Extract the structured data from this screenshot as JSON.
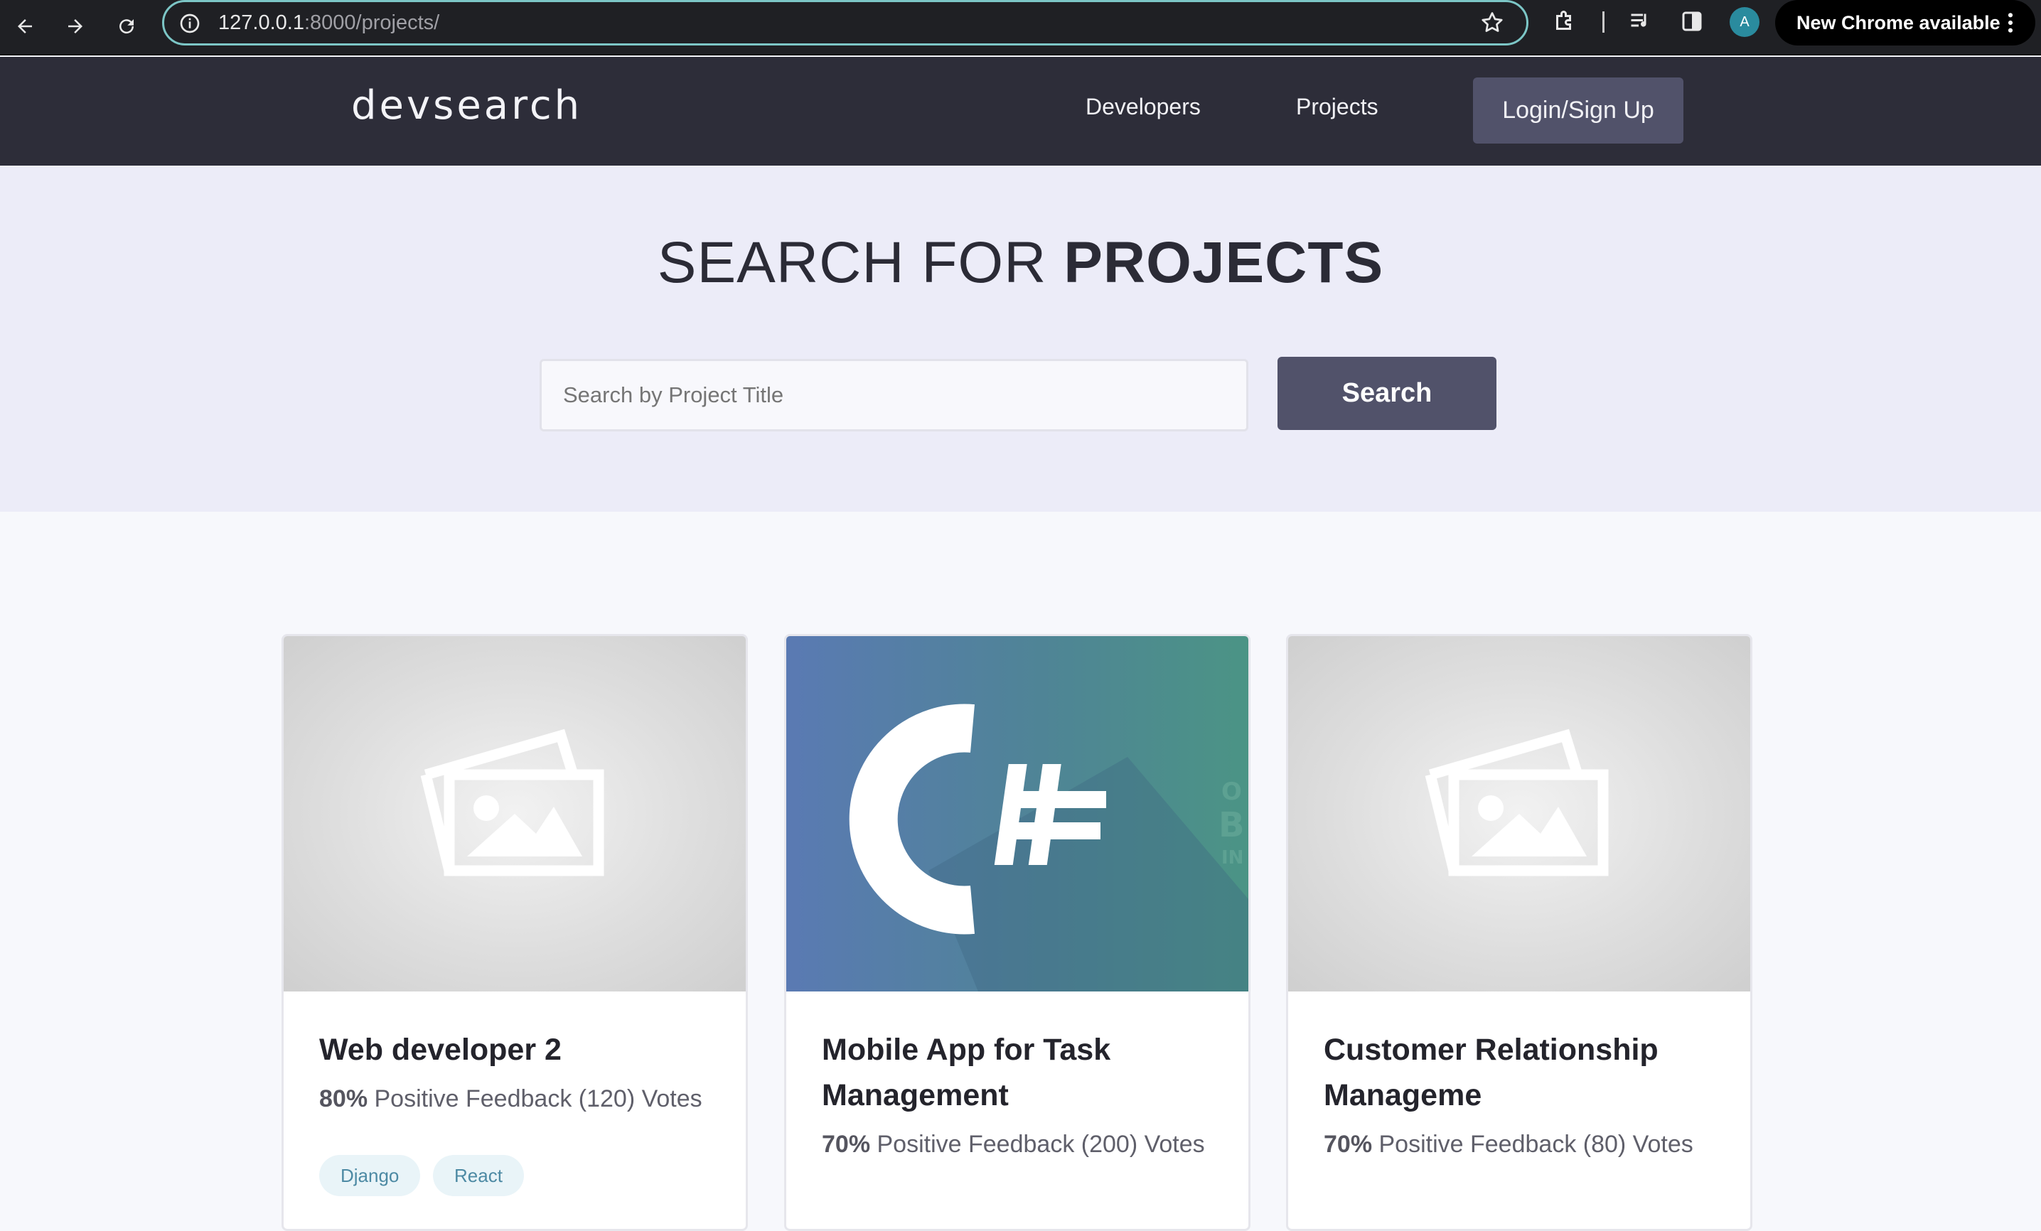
{
  "browser": {
    "url_host": "127.0.0.1",
    "url_path": ":8000/projects/",
    "profile_initial": "A",
    "update_label": "New Chrome available"
  },
  "header": {
    "logo": "devsearch",
    "nav": [
      {
        "label": "Developers"
      },
      {
        "label": "Projects"
      }
    ],
    "login_label": "Login/Sign Up"
  },
  "hero": {
    "title_light": "SEARCH FOR ",
    "title_bold": "PROJECTS",
    "search_placeholder": "Search by Project Title",
    "search_button": "Search"
  },
  "projects": [
    {
      "title": "Web developer 2",
      "feedback_pct": "80%",
      "feedback_text": " Positive Feedback (120) Votes",
      "tags": [
        "Django",
        "React"
      ],
      "image": "placeholder-image-icon"
    },
    {
      "title": "Mobile App for Task Management",
      "feedback_pct": "70%",
      "feedback_text": " Positive Feedback (200) Votes",
      "tags": [],
      "image": "csharp-logo"
    },
    {
      "title": "Customer Relationship Manageme",
      "feedback_pct": "70%",
      "feedback_text": " Positive Feedback (80) Votes",
      "tags": [],
      "image": "placeholder-image-icon"
    }
  ],
  "colors": {
    "header_bg": "#2d2d39",
    "hero_bg": "#ececf8",
    "accent_button": "#51526a",
    "tag_bg": "#e9f4f8",
    "tag_text": "#4d8aa4"
  }
}
